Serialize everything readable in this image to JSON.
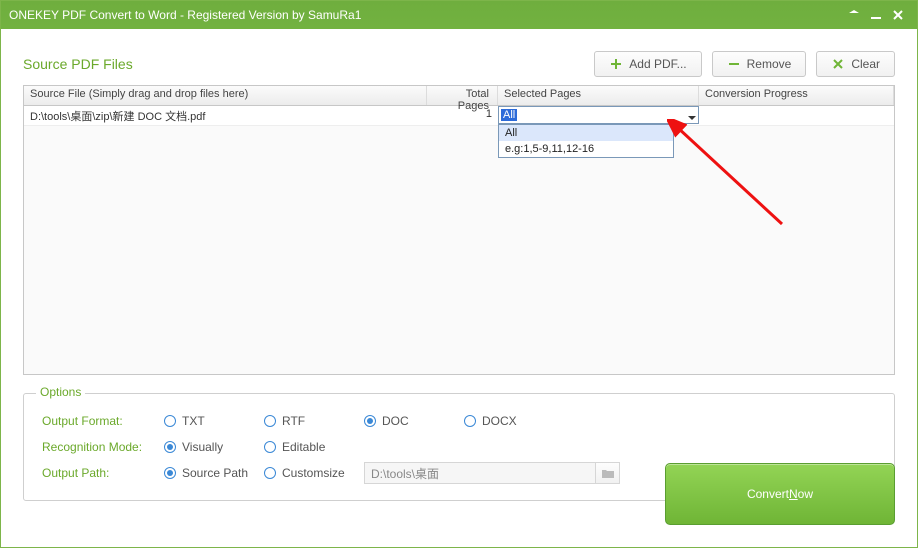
{
  "window": {
    "title": "ONEKEY PDF Convert to Word - Registered Version by SamuRa1"
  },
  "header": {
    "source_label": "Source PDF Files",
    "add_pdf": "Add PDF...",
    "remove": "Remove",
    "clear": "Clear"
  },
  "grid": {
    "columns": {
      "source": "Source File (Simply drag and drop files here)",
      "total": "Total Pages",
      "selected": "Selected Pages",
      "progress": "Conversion Progress"
    },
    "rows": [
      {
        "source": "D:\\tools\\桌面\\zip\\新建 DOC 文档.pdf",
        "total": "1",
        "selected": "All",
        "progress": ""
      }
    ],
    "dropdown": {
      "opt_all": "All",
      "opt_example": "e.g:1,5-9,11,12-16"
    }
  },
  "options": {
    "legend": "Options",
    "output_format_label": "Output Format:",
    "formats": {
      "txt": "TXT",
      "rtf": "RTF",
      "doc": "DOC",
      "docx": "DOCX"
    },
    "selected_format": "doc",
    "recognition_label": "Recognition Mode:",
    "recognition": {
      "visually": "Visually",
      "editable": "Editable"
    },
    "selected_recognition": "visually",
    "output_path_label": "Output Path:",
    "path_modes": {
      "source": "Source Path",
      "custom": "Customsize"
    },
    "selected_path_mode": "source",
    "custom_path": "D:\\tools\\桌面"
  },
  "convert": {
    "label_pre": "Convert ",
    "label_key": "N",
    "label_post": "ow"
  },
  "icons": {
    "plus": "plus-icon",
    "minus": "minus-icon",
    "x": "x-icon"
  }
}
